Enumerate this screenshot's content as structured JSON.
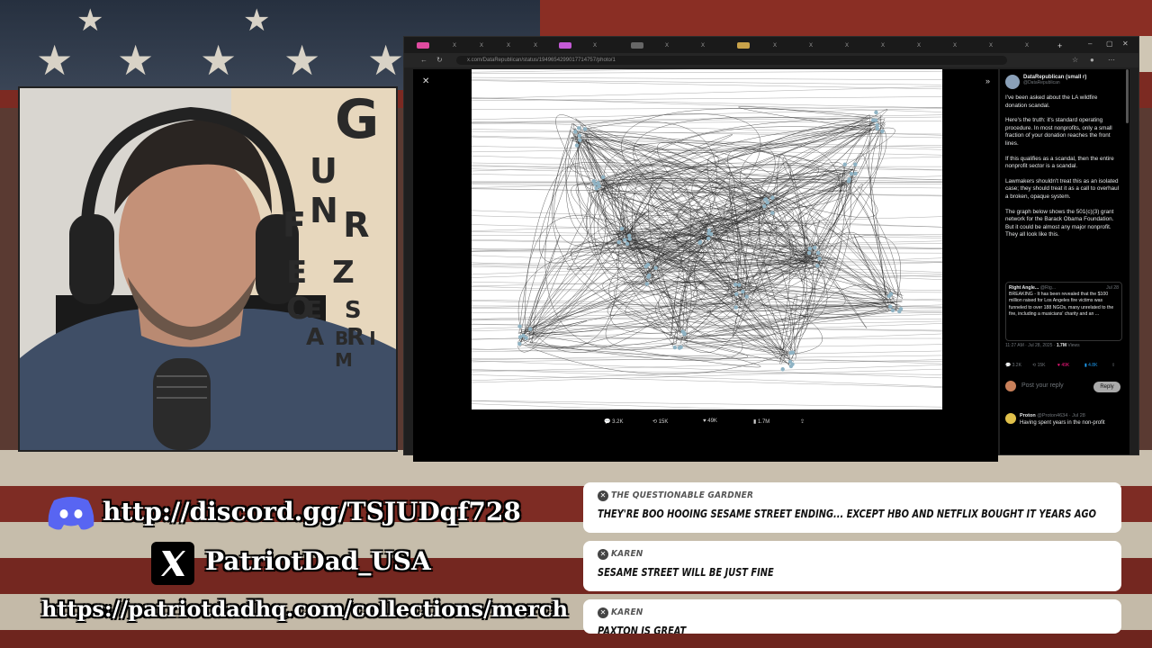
{
  "browser": {
    "url": "x.com/DataRepublican/status/1949654299017714757/photo/1",
    "tabs_label": "X",
    "window_controls": [
      "–",
      "▢",
      "✕"
    ]
  },
  "viewer": {
    "close": "✕",
    "expand": "»",
    "actions": {
      "replies": "3.2K",
      "reposts": "15K",
      "likes": "49K",
      "views": "1.7M"
    }
  },
  "post": {
    "author_name": "DataRepublican (small r)",
    "author_handle": "@DataRepublican",
    "paragraphs": [
      "I've been asked about the LA wildfire donation scandal.",
      "Here's the truth: it's standard operating procedure. In most nonprofits, only a small fraction of your donation reaches the front lines.",
      "If this qualifies as a scandal, then the entire nonprofit sector is a scandal.",
      "Lawmakers shouldn't treat this as an isolated case; they should treat it as a call to overhaul a broken, opaque system.",
      "The graph below shows the 501(c)(3) grant network for the Barack Obama Foundation. But it could be almost any major nonprofit. They all look like this."
    ],
    "quote": {
      "author": "Right Angle...",
      "handle": "@Rig...",
      "date": "Jul 28",
      "text": "BREAKING - It has been revealed that the $100 million raised for Los Angeles fire victims was funneled to over 188 NGOs, many unrelated to the fire, including a musicians' charity and an ..."
    },
    "timestamp": "11:27 AM · Jul 28, 2025 ·",
    "views_count": "1.7M",
    "views_label": "Views",
    "stats": {
      "replies": "3.2K",
      "reposts": "15K",
      "likes": "49K",
      "bookmarks": "4.8K"
    },
    "reply_placeholder": "Post your reply",
    "reply_button": "Reply",
    "next_reply": {
      "author": "Proton",
      "handle": "@Proton4634 · Jul 28",
      "text": "Having spent years in the non-profit"
    }
  },
  "webcam": {
    "eye_chart_rows": [
      "G",
      "U N",
      "F R",
      "E Z O",
      "E S A R",
      "B I M"
    ]
  },
  "socials": {
    "discord": "http://discord.gg/TSJUDqf728",
    "x_handle": "PatriotDad_USA",
    "merch": "https://patriotdadhq.com/collections/merch"
  },
  "chat": [
    {
      "user": "THE QUESTIONABLE GARDNER",
      "message": "THEY'RE BOO HOOING SESAME STREET ENDING... EXCEPT HBO AND NETFLIX BOUGHT IT YEARS AGO"
    },
    {
      "user": "KAREN",
      "message": "SESAME STREET WILL BE JUST FINE"
    },
    {
      "user": "KAREN",
      "message": "PAXTON IS GREAT"
    }
  ],
  "colors": {
    "accent_blue": "#1d9bf0",
    "like_pink": "#f91880",
    "chat_bg": "#ffffff"
  }
}
